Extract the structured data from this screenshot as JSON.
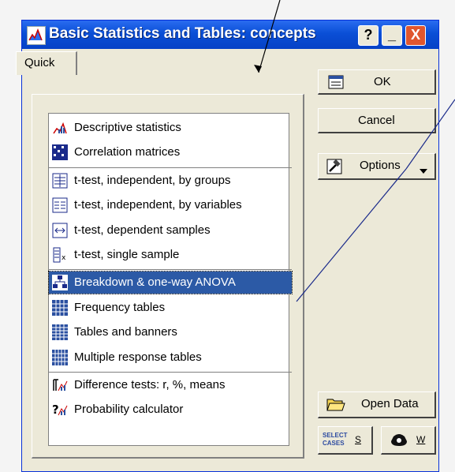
{
  "window": {
    "title": "Basic Statistics and Tables: concepts",
    "help_label": "?",
    "minimize_label": "_",
    "close_label": "X"
  },
  "tab": {
    "label": "Quick"
  },
  "list": {
    "items": [
      {
        "label": "Descriptive statistics",
        "icon": "descriptive-stats-icon"
      },
      {
        "label": "Correlation matrices",
        "icon": "correlation-matrix-icon"
      },
      {
        "label": "t-test, independent, by groups",
        "icon": "ttest-groups-icon"
      },
      {
        "label": "t-test, independent, by variables",
        "icon": "ttest-variables-icon"
      },
      {
        "label": "t-test, dependent samples",
        "icon": "ttest-dependent-icon"
      },
      {
        "label": "t-test, single sample",
        "icon": "ttest-single-icon"
      },
      {
        "label": "Breakdown & one-way ANOVA",
        "icon": "anova-icon",
        "selected": true
      },
      {
        "label": "Frequency tables",
        "icon": "frequency-table-icon"
      },
      {
        "label": "Tables and banners",
        "icon": "banners-table-icon"
      },
      {
        "label": "Multiple response tables",
        "icon": "multi-response-icon"
      },
      {
        "label": "Difference tests: r, %, means",
        "icon": "difference-tests-icon"
      },
      {
        "label": "Probability calculator",
        "icon": "probability-calc-icon"
      }
    ]
  },
  "buttons": {
    "ok": "OK",
    "cancel": "Cancel",
    "options": "Options",
    "open_data": "Open Data",
    "select_cases_icon_text": "SELECT CASES",
    "select_cases_hotkey": "S",
    "weight_hotkey": "W"
  },
  "colors": {
    "titlebar": "#0a4fd6",
    "selection": "#2c5aa6",
    "close": "#e0562e"
  }
}
